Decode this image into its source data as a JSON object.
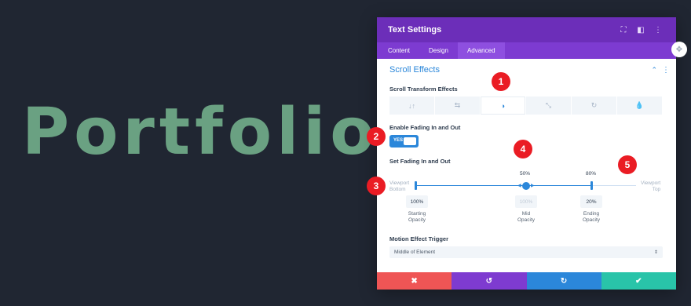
{
  "background": {
    "title": "Portfolio"
  },
  "modal": {
    "title": "Text Settings",
    "tabs": [
      "Content",
      "Design",
      "Advanced"
    ],
    "active_tab": "Advanced",
    "section_title": "Scroll Effects",
    "scroll_transform_label": "Scroll Transform Effects",
    "effects": [
      "vertical-motion",
      "horizontal-motion",
      "fading",
      "scaling",
      "rotating",
      "blur"
    ],
    "active_effect": "fading",
    "enable_label": "Enable Fading In and Out",
    "toggle_label": "YES",
    "set_label": "Set Fading In and Out",
    "viewport_bottom": [
      "Viewport",
      "Bottom"
    ],
    "viewport_top": [
      "Viewport",
      "Top"
    ],
    "mid_percent": "50%",
    "end_percent": "80%",
    "starting_opacity": "100%",
    "mid_opacity": "100%",
    "ending_opacity": "20%",
    "starting_label": [
      "Starting",
      "Opacity"
    ],
    "mid_label": [
      "Mid",
      "Opacity"
    ],
    "ending_label": [
      "Ending",
      "Opacity"
    ],
    "trigger_label": "Motion Effect Trigger",
    "trigger_value": "Middle of Element"
  },
  "badges": [
    "1",
    "2",
    "3",
    "4",
    "5"
  ],
  "colors": {
    "accent": "#2b87da",
    "header": "#6c2eb9",
    "tabs": "#7d3bd1",
    "cancel": "#ef5555",
    "undo": "#7e3bd0",
    "redo": "#2b87da",
    "save": "#29c4a9",
    "badge": "#ea1c24",
    "title_text": "#6aa182"
  }
}
